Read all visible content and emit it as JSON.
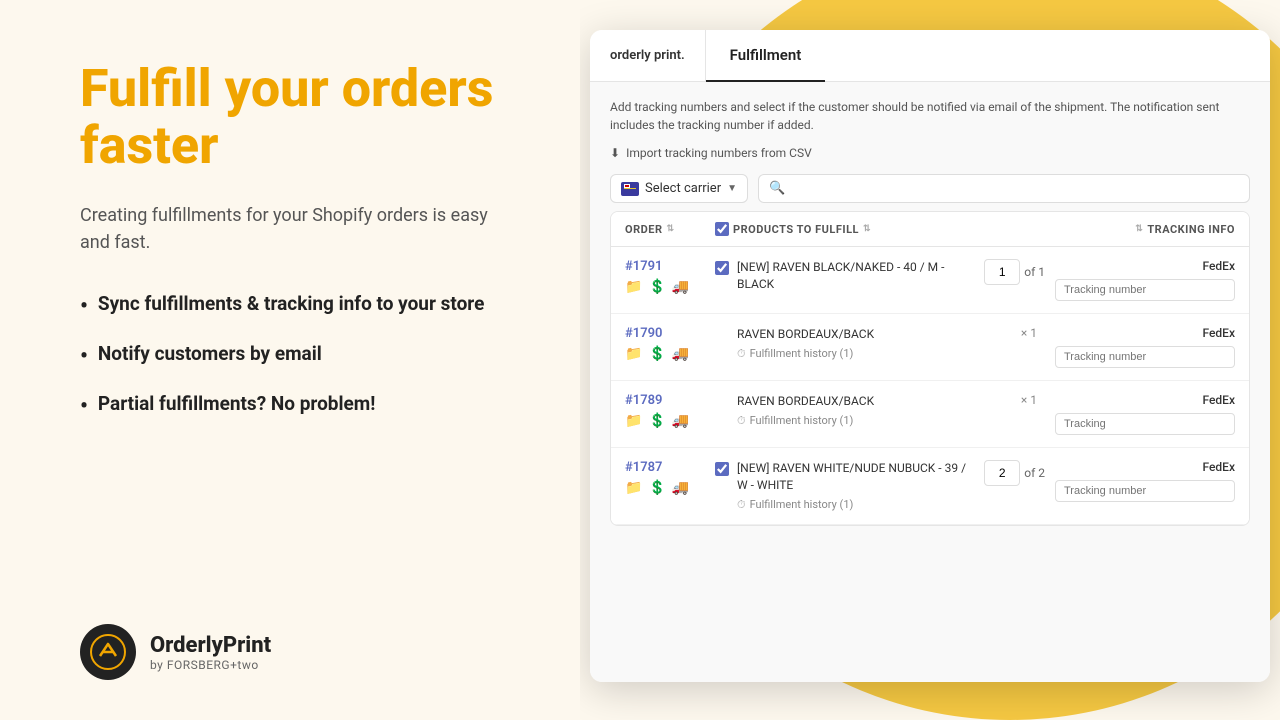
{
  "left": {
    "hero_title": "Fulfill your orders faster",
    "subtitle": "Creating fulfillments for your Shopify orders is easy and fast.",
    "bullets": [
      "Sync fulfillments & tracking info to your store",
      "Notify customers by email",
      "Partial fulfillments? No problem!"
    ],
    "brand_name": "OrderlyPrint",
    "brand_sub": "by FORSBERG+two"
  },
  "app": {
    "logo_text": "orderly print.",
    "tab_label": "Fulfillment",
    "info_text": "Add tracking numbers and select if the customer should be notified via email of the shipment. The notification sent includes the tracking number if added.",
    "import_link": "Import tracking numbers from CSV",
    "carrier_select_label": "Select carrier",
    "table_headers": {
      "order": "ORDER",
      "products": "PRODUCTS TO FULFILL",
      "tracking": "TRACKING INFO"
    },
    "orders": [
      {
        "id": "#1791",
        "has_checkbox": true,
        "checked": true,
        "product": "[NEW] RAVEN BLACK/NAKED - 40 / M - BLACK",
        "qty": "1",
        "qty_of": "1",
        "carrier": "FedEx",
        "tracking_placeholder": "Tracking number",
        "history": null
      },
      {
        "id": "#1790",
        "has_checkbox": false,
        "checked": false,
        "product": "RAVEN BORDEAUX/BACK",
        "qty": null,
        "qty_of": null,
        "multiply_qty": "× 1",
        "carrier": "FedEx",
        "tracking_placeholder": "Tracking number",
        "history": "Fulfillment history (1)"
      },
      {
        "id": "#1789",
        "has_checkbox": false,
        "checked": false,
        "product": "RAVEN BORDEAUX/BACK",
        "qty": null,
        "qty_of": null,
        "multiply_qty": "× 1",
        "carrier": "FedEx",
        "tracking_placeholder": "Tracking",
        "history": "Fulfillment history (1)"
      },
      {
        "id": "#1787",
        "has_checkbox": true,
        "checked": true,
        "product": "[NEW] RAVEN WHITE/NUDE NUBUCK - 39 / W - WHITE",
        "qty": "2",
        "qty_of": "2",
        "carrier": "FedEx",
        "tracking_placeholder": "Tracking number",
        "history": "Fulfillment history (1)"
      }
    ]
  }
}
